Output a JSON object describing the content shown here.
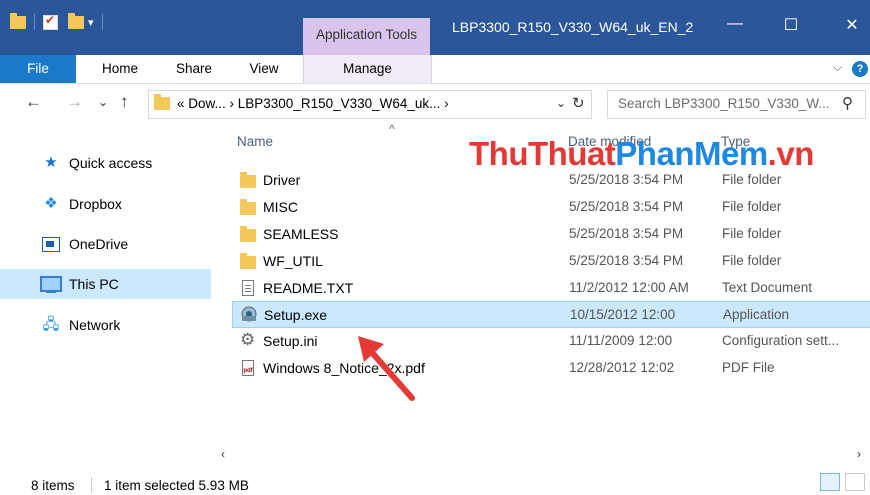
{
  "window": {
    "context_tab": "Application Tools",
    "title": "LBP3300_R150_V330_W64_uk_EN_2",
    "minimize": "—",
    "maximize": "☐",
    "close": "✕"
  },
  "ribbon": {
    "tabs": [
      "File",
      "Home",
      "Share",
      "View",
      "Manage"
    ],
    "expand": "⌵",
    "help": "?"
  },
  "address": {
    "path": "« Dow...  ›  LBP3300_R150_V330_W64_uk...  ›",
    "search_placeholder": "Search LBP3300_R150_V330_W...",
    "back": "←",
    "forward": "→",
    "recent": "⌄",
    "up": "↑",
    "dropdown": "⌄",
    "refresh": "↻",
    "search_icon": "⚲"
  },
  "sidebar": {
    "items": [
      {
        "label": "Quick access",
        "icon": "star-icon"
      },
      {
        "label": "Dropbox",
        "icon": "dropbox-icon"
      },
      {
        "label": "OneDrive",
        "icon": "onedrive-icon"
      },
      {
        "label": "This PC",
        "icon": "computer-icon",
        "selected": true
      },
      {
        "label": "Network",
        "icon": "network-icon"
      }
    ]
  },
  "columns": {
    "name": "Name",
    "date": "Date modified",
    "type": "Type",
    "sort_indicator": "^"
  },
  "files": [
    {
      "name": "Driver",
      "date": "5/25/2018 3:54 PM",
      "type": "File folder",
      "icon": "folder-icon"
    },
    {
      "name": "MISC",
      "date": "5/25/2018 3:54 PM",
      "type": "File folder",
      "icon": "folder-icon"
    },
    {
      "name": "SEAMLESS",
      "date": "5/25/2018 3:54 PM",
      "type": "File folder",
      "icon": "folder-icon"
    },
    {
      "name": "WF_UTIL",
      "date": "5/25/2018 3:54 PM",
      "type": "File folder",
      "icon": "folder-icon"
    },
    {
      "name": "README.TXT",
      "date": "11/2/2012 12:00 AM",
      "type": "Text Document",
      "icon": "text-file-icon"
    },
    {
      "name": "Setup.exe",
      "date": "10/15/2012 12:00",
      "type": "Application",
      "icon": "setup-exe-icon",
      "selected": true
    },
    {
      "name": "Setup.ini",
      "date": "11/11/2009 12:00",
      "type": "Configuration sett...",
      "icon": "config-file-icon"
    },
    {
      "name": "Windows 8_Notice_2x.pdf",
      "date": "12/28/2012 12:02",
      "type": "PDF File",
      "icon": "pdf-icon"
    }
  ],
  "watermark": {
    "part1": "ThuThuat",
    "part2": "PhanMem",
    "part3": ".vn"
  },
  "status": {
    "items": "8 items",
    "selection": "1 item selected  5.93 MB"
  },
  "colors": {
    "titlebar": "#2b579a",
    "app_tools": "#d8c4ec",
    "file_tab": "#1979ca",
    "selection": "#cce8ff",
    "arrow": "#e53935"
  }
}
